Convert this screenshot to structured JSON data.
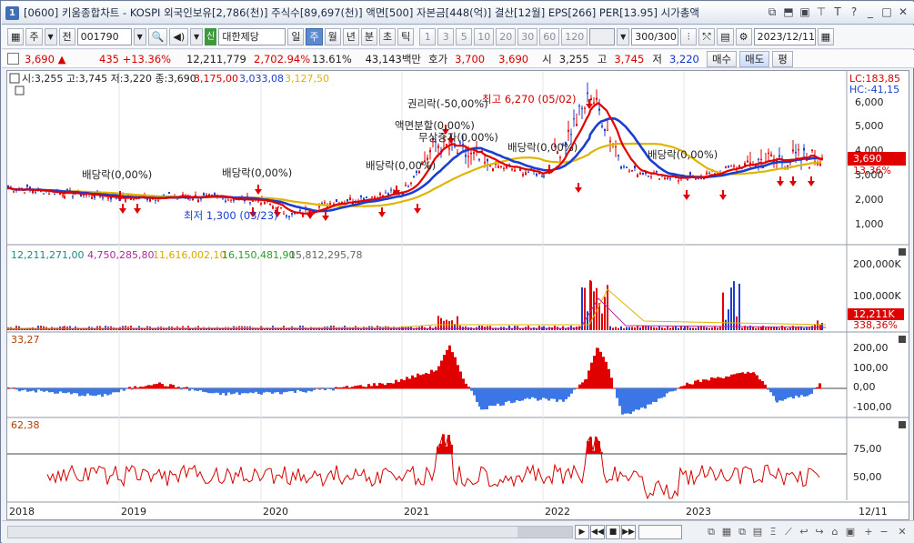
{
  "window": {
    "number": "1",
    "title": "[0600] 키움종합차트 - KOSPI 외국인보유[2,786(천)] 주식수[89,697(천)] 액면[500] 자본금[448(억)] 결산[12월] EPS[266] PER[13.95] 시가총액",
    "icons": [
      "restore-icon",
      "pin-icon",
      "window-icon",
      "pin-up-icon",
      "text-icon",
      "help-icon",
      "minimize-icon",
      "maximize-icon",
      "close-icon"
    ]
  },
  "toolbar": {
    "period_label": "주",
    "prev_label": "전",
    "code": "001790",
    "stock_badge": "신",
    "stock_name": "대한제당",
    "periods": [
      "일",
      "주",
      "월",
      "년",
      "분",
      "초",
      "틱"
    ],
    "active_period": "주",
    "intervals": [
      "1",
      "3",
      "5",
      "10",
      "20",
      "30",
      "60",
      "120"
    ],
    "count": "300/300",
    "date": "2023/12/11"
  },
  "quote": {
    "price": "3,690 ▲",
    "change": "435 +13.36%",
    "volume": "12,211,779",
    "volume_pct": "2,702.94%",
    "rate": "13.61%",
    "amount": "43,143백만",
    "bid_label": "호가",
    "ask": "3,700",
    "bid": "3,690",
    "open_label": "시",
    "open": "3,255",
    "high_label": "고",
    "high": "3,745",
    "low_label": "저",
    "low": "3,220",
    "buy_label": "매수",
    "sell_label": "매도",
    "avg_label": "평"
  },
  "chart_data": [
    {
      "type": "candlestick",
      "legend": {
        "ohlc": "시:3,255 고:3,745 저:3,220 종:3,690",
        "ma_values": [
          "3,175,00",
          "3,033,08",
          "3,127,50"
        ],
        "ma_colors": [
          "#d40000",
          "#1a3fd0",
          "#e0b400"
        ]
      },
      "lc_hc": [
        "LC:183,85",
        "HC:-41,15"
      ],
      "y_ticks": [
        "6,000",
        "5,000",
        "4,000",
        "3,000",
        "2,000",
        "1,000"
      ],
      "current_price": "3,690",
      "current_pct": "13,36%",
      "annotations": {
        "high": "최고 6,270 (05/02)",
        "low": "최저 1,300 (03/23)",
        "events": [
          "배당락(0,00%)",
          "배당락(0,00%)",
          "배당락(0,00%)",
          "권리락(-50,00%)",
          "액면분할(0,00%)",
          "무상증자(0,00%)",
          "배당락(0,00%)",
          "배당락(0,00%)"
        ]
      },
      "x_labels": [
        "2018",
        "2019",
        "2020",
        "2021",
        "2022",
        "2023",
        "12/11"
      ],
      "series": [
        {
          "name": "price",
          "x": [
            "2018-01",
            "2018-07",
            "2019-01",
            "2019-07",
            "2020-01",
            "2020-03",
            "2020-07",
            "2021-01",
            "2021-03",
            "2021-07",
            "2022-01",
            "2022-05",
            "2022-07",
            "2023-01",
            "2023-07",
            "2023-12"
          ],
          "values": [
            2450,
            2250,
            2050,
            2100,
            1950,
            1300,
            1850,
            2300,
            4300,
            3400,
            3000,
            6270,
            3200,
            2800,
            3600,
            3690
          ]
        }
      ]
    },
    {
      "type": "bar",
      "legend": [
        "12,211,271,00",
        "4,750,285,80",
        "11,616,002,10",
        "16,150,481,90",
        "15,812,295,78"
      ],
      "legend_colors": [
        "#1a8a8a",
        "#b02aa0",
        "#d8a800",
        "#2a9d2a",
        "#666666"
      ],
      "y_ticks": [
        "200,000K",
        "100,000K"
      ],
      "current_value": "12,211K",
      "current_pct": "338,36%"
    },
    {
      "type": "area",
      "value": "33,27",
      "y_ticks": [
        "200,00",
        "100,00",
        "0,00",
        "-100,00"
      ]
    },
    {
      "type": "line",
      "value": "62,38",
      "y_ticks": [
        "75,00",
        "50,00"
      ]
    }
  ],
  "bottom": {
    "nav": [
      "▶",
      "◀◀",
      "■",
      "▶▶"
    ]
  }
}
